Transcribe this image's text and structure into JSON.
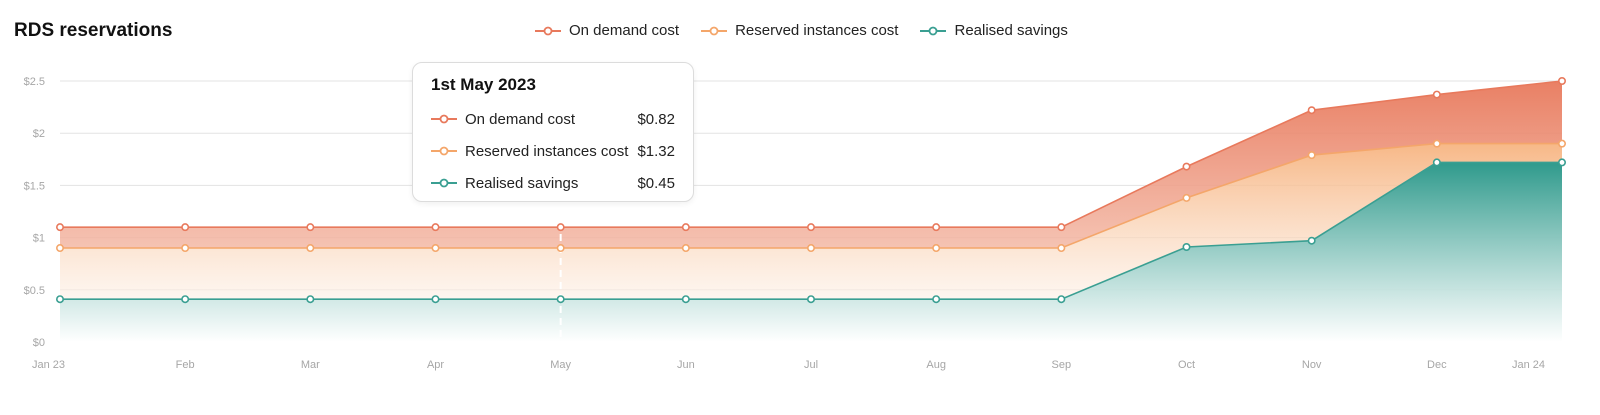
{
  "chart_data": {
    "type": "area",
    "title": "RDS reservations",
    "categories": [
      "Jan 23",
      "Feb",
      "Mar",
      "Apr",
      "May",
      "Jun",
      "Jul",
      "Aug",
      "Sep",
      "Oct",
      "Nov",
      "Dec",
      "Jan 24"
    ],
    "series": [
      {
        "name": "On demand cost",
        "color": "#e8795c",
        "values": [
          1.1,
          1.1,
          1.1,
          1.1,
          1.1,
          1.1,
          1.1,
          1.1,
          1.1,
          1.68,
          2.22,
          2.37,
          2.5
        ]
      },
      {
        "name": "Reserved instances cost",
        "color": "#f4a66a",
        "values": [
          0.9,
          0.9,
          0.9,
          0.9,
          0.9,
          0.9,
          0.9,
          0.9,
          0.9,
          1.38,
          1.79,
          1.9,
          1.9
        ]
      },
      {
        "name": "Realised savings",
        "color": "#3a9f92",
        "values": [
          0.41,
          0.41,
          0.41,
          0.41,
          0.41,
          0.41,
          0.41,
          0.41,
          0.41,
          0.91,
          0.97,
          1.72,
          1.72
        ]
      }
    ],
    "yticks": [
      "$0",
      "$0.5",
      "$1",
      "$1.5",
      "$2",
      "$2.5"
    ],
    "ylim": [
      0,
      2.5
    ],
    "grid": true,
    "legend": "top-center"
  },
  "tooltip": {
    "date": "1st May 2023",
    "category_index": 4,
    "rows": [
      {
        "label": "On demand cost",
        "value": "$0.82"
      },
      {
        "label": "Reserved instances cost",
        "value": "$1.32"
      },
      {
        "label": "Realised savings",
        "value": "$0.45"
      }
    ]
  }
}
